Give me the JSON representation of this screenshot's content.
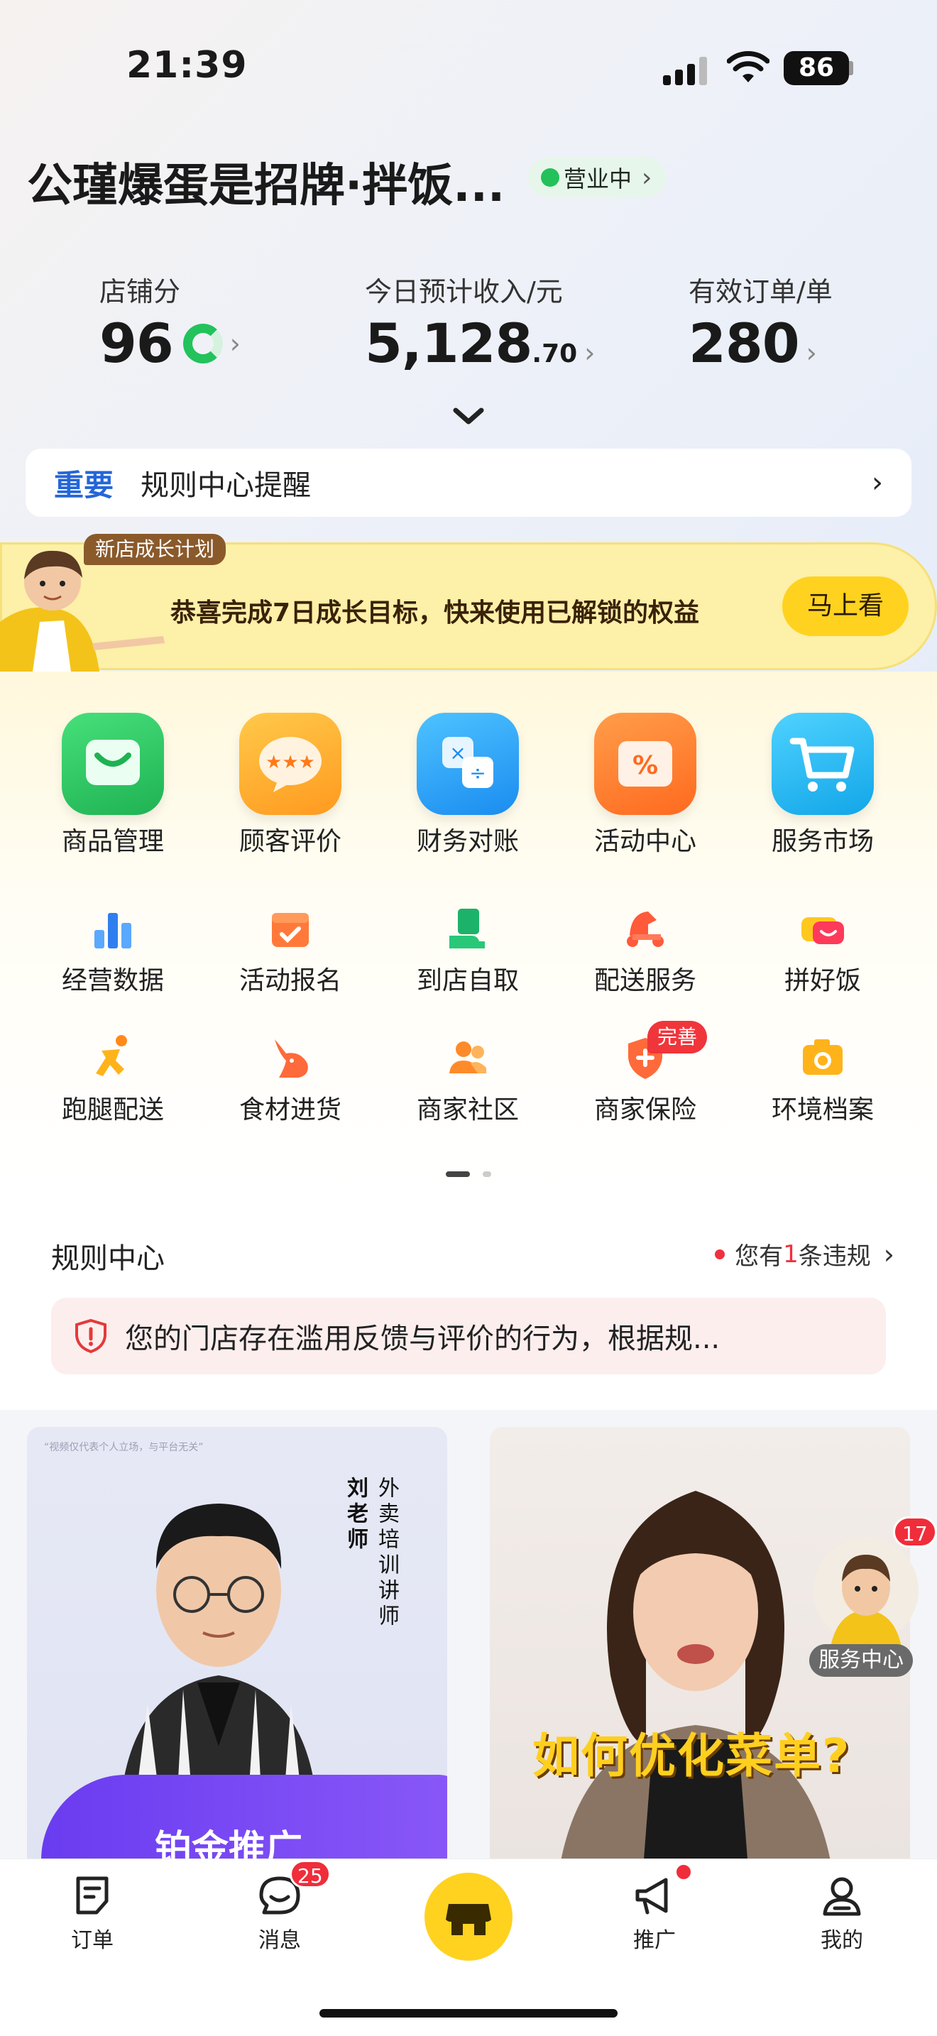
{
  "status_bar": {
    "time": "21:39",
    "battery": "86"
  },
  "store": {
    "name": "公瑾爆蛋是招牌·拌饭...",
    "status": "营业中"
  },
  "metrics": {
    "score": {
      "label": "店铺分",
      "value": "96"
    },
    "income": {
      "label": "今日预计收入/元",
      "value_int": "5,128",
      "value_dec": ".70"
    },
    "orders": {
      "label": "有效订单/单",
      "value": "280"
    }
  },
  "notice": {
    "tag": "重要",
    "text": "规则中心提醒"
  },
  "growth": {
    "tag": "新店成长计划",
    "text": "恭喜完成7日成长目标，快来使用已解锁的权益",
    "button": "马上看"
  },
  "grid": {
    "row1": [
      "商品管理",
      "顾客评价",
      "财务对账",
      "活动中心",
      "服务市场"
    ],
    "row2": [
      "经营数据",
      "活动报名",
      "到店自取",
      "配送服务",
      "拼好饭"
    ],
    "row3": [
      "跑腿配送",
      "食材进货",
      "商家社区",
      "商家保险",
      "环境档案"
    ],
    "insurance_badge": "完善"
  },
  "rule_center": {
    "title": "规则中心",
    "violation_prefix": "您有",
    "violation_count": "1",
    "violation_suffix": "条违规",
    "warning": "您的门店存在滥用反馈与评价的行为，根据规..."
  },
  "videos": [
    {
      "note": "“视频仅代表个人立场，与平台无关”",
      "teacher": "刘老师",
      "role": "外卖培训讲师",
      "banner": "铂金推广"
    },
    {
      "title": "如何优化菜单?"
    }
  ],
  "service_center": {
    "label": "服务中心",
    "badge": "17"
  },
  "tabbar": {
    "orders": "订单",
    "messages": "消息",
    "messages_badge": "25",
    "promote": "推广",
    "mine": "我的"
  },
  "colors": {
    "accent_yellow": "#ffd21f",
    "green": "#23c15a",
    "blue": "#2466d8",
    "red": "#f03040"
  }
}
